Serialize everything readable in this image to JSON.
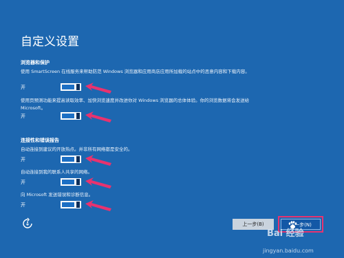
{
  "page_title": "自定义设置",
  "sections": [
    {
      "heading": "浏览器和保护",
      "settings": [
        {
          "description": "使用 SmartScreen 在线服务来帮助防范 Windows 浏览器和应用商店应用所加载的站点中的恶意内容和下载内容。",
          "state": "开",
          "on": true
        },
        {
          "description": "使用页预测功能来提高读取效率、加快浏览速度并改进你对 Windows 浏览器的总体体验。你的浏览数据将会发送给 Microsoft。",
          "state": "开",
          "on": true
        }
      ]
    },
    {
      "heading": "连接性和错误报告",
      "settings": [
        {
          "description": "自动连接到建议的开放热点。并非所有网络都是安全的。",
          "state": "开",
          "on": true
        },
        {
          "description": "自动连接到我的联系人共享的网络。",
          "state": "开",
          "on": true
        },
        {
          "description": "向 Microsoft 发送错误和诊断信息。",
          "state": "开",
          "on": true
        }
      ]
    }
  ],
  "buttons": {
    "back": "上一步(B)",
    "next": "下一步(N)"
  },
  "watermark": {
    "brand": "Bai 经验",
    "url": "jingyan.baidu.com"
  },
  "colors": {
    "background": "#1d67b0",
    "annotation_arrow": "#e8336f",
    "toggle_on": "#1c6fc4"
  },
  "icons": {
    "accessibility": "ease-of-access-icon",
    "annotation": "pink-arrow"
  }
}
